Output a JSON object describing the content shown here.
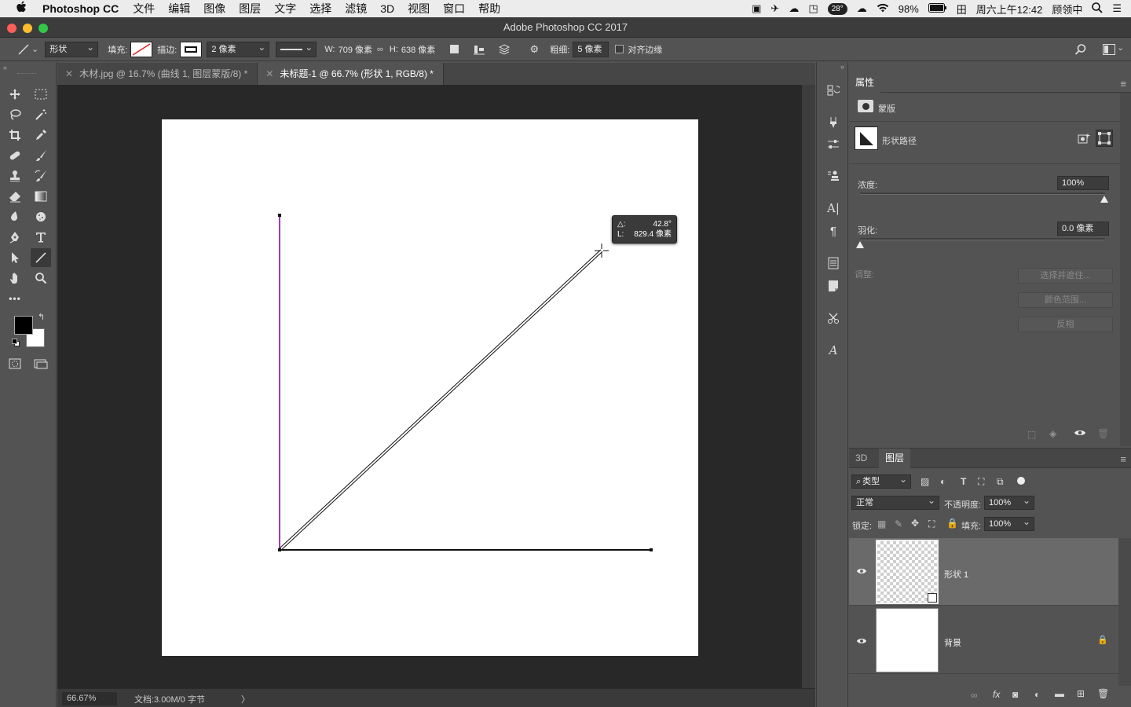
{
  "menubar": {
    "app_name": "Photoshop CC",
    "items": [
      "文件",
      "编辑",
      "图像",
      "图层",
      "文字",
      "选择",
      "滤镜",
      "3D",
      "视图",
      "窗口",
      "帮助"
    ],
    "temperature": "28°",
    "battery": "98%",
    "ime": "田",
    "clock": "周六上午12:42",
    "user": "顾领中"
  },
  "window": {
    "title": "Adobe Photoshop CC 2017"
  },
  "options": {
    "mode": "形状",
    "fill_label": "填充:",
    "stroke_label": "描边:",
    "stroke_width": "2 像素",
    "w_label": "W:",
    "w_value": "709 像素",
    "h_label": "H:",
    "h_value": "638 像素",
    "weight_label": "粗细:",
    "weight_value": "5 像素",
    "align_edges": "对齐边缘"
  },
  "tabs": [
    {
      "label": "木材.jpg @ 16.7% (曲线 1, 图层蒙版/8) *",
      "active": false
    },
    {
      "label": "未标题-1 @ 66.7% (形状 1, RGB/8) *",
      "active": true
    }
  ],
  "canvas": {
    "readout_angle_label": "△:",
    "readout_angle": "42.8°",
    "readout_length_label": "L:",
    "readout_length": "829.4 像素",
    "colors": {
      "vertical_line": "#9b3fb0",
      "lines": "#111111"
    }
  },
  "status": {
    "zoom": "66.67%",
    "doc": "文档:3.00M/0 字节",
    "arrow": "〉"
  },
  "properties": {
    "tab": "属性",
    "mask_label": "蒙版",
    "shape_path_label": "形状路径",
    "density_label": "浓度:",
    "density_value": "100%",
    "feather_label": "羽化:",
    "feather_value": "0.0 像素",
    "adjust_label": "调整:",
    "btn_select_mask": "选择并遮住...",
    "btn_color_range": "颜色范围...",
    "btn_invert": "反相"
  },
  "layers_panel": {
    "tab_3d": "3D",
    "tab_layers": "图层",
    "filter_kind": "类型",
    "blend_mode": "正常",
    "opacity_label": "不透明度:",
    "opacity_value": "100%",
    "lock_label": "锁定:",
    "fill_label": "填充:",
    "fill_value": "100%",
    "layers": [
      {
        "name": "形状 1",
        "selected": true
      },
      {
        "name": "背景",
        "selected": false
      }
    ]
  }
}
